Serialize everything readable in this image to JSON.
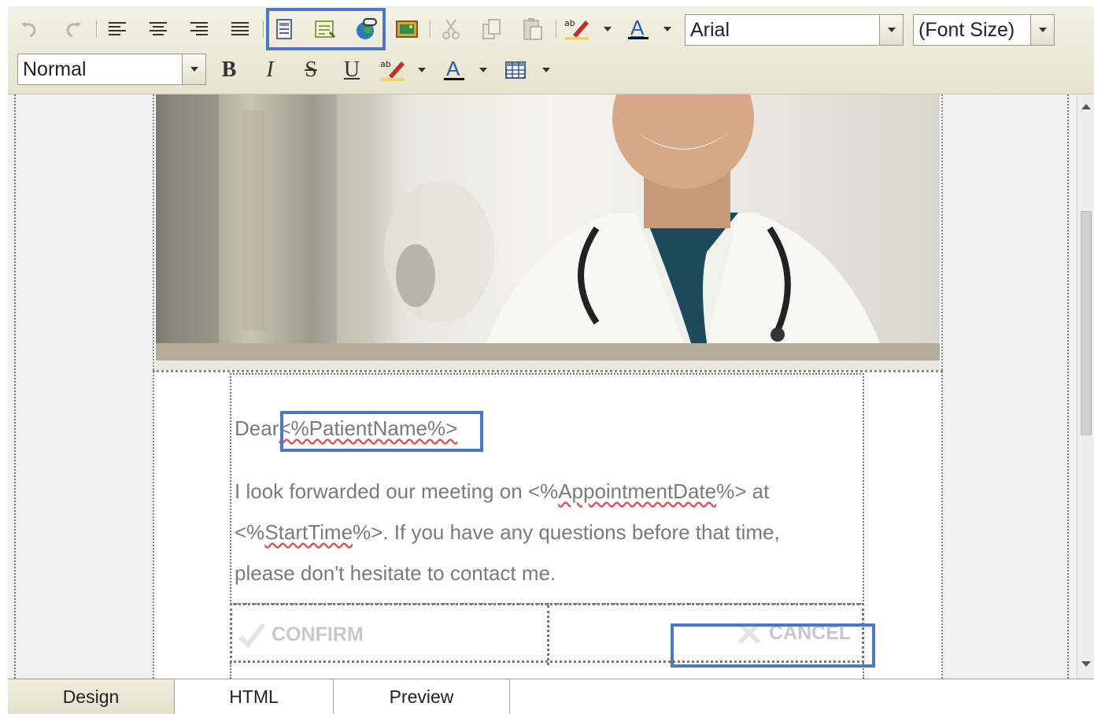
{
  "toolbar": {
    "row1_icons": [
      "undo-icon",
      "redo-icon",
      "align-left-icon",
      "align-center-icon",
      "align-right-icon",
      "justify-icon",
      "insert-template-icon",
      "insert-snippet-icon",
      "insert-link-icon",
      "insert-image-icon",
      "cut-icon",
      "copy-icon",
      "paste-icon",
      "highlight-color-icon",
      "font-color-icon"
    ],
    "font_name": "Arial",
    "font_size": "(Font Size)",
    "paragraph_style": "Normal",
    "bold": "B",
    "italic": "I",
    "strike": "S",
    "underline": "U",
    "accent_color": "#4a78c4"
  },
  "email": {
    "greeting_word": "Dear",
    "patient_tag": "<%PatientName%>",
    "line1_a": "I look forwarded our meeting on <%",
    "line1_tag": "AppointmentDate",
    "line1_b": "%> at",
    "line2_a": "<%",
    "line2_tag": "StartTime",
    "line2_b": "%>. If you have any questions before that time,",
    "line3": "please don't hesitate to contact me.",
    "confirm_label": "CONFIRM",
    "cancel_label": "CANCEL"
  },
  "tabs": [
    {
      "label": "Design"
    },
    {
      "label": "HTML"
    },
    {
      "label": "Preview"
    }
  ]
}
